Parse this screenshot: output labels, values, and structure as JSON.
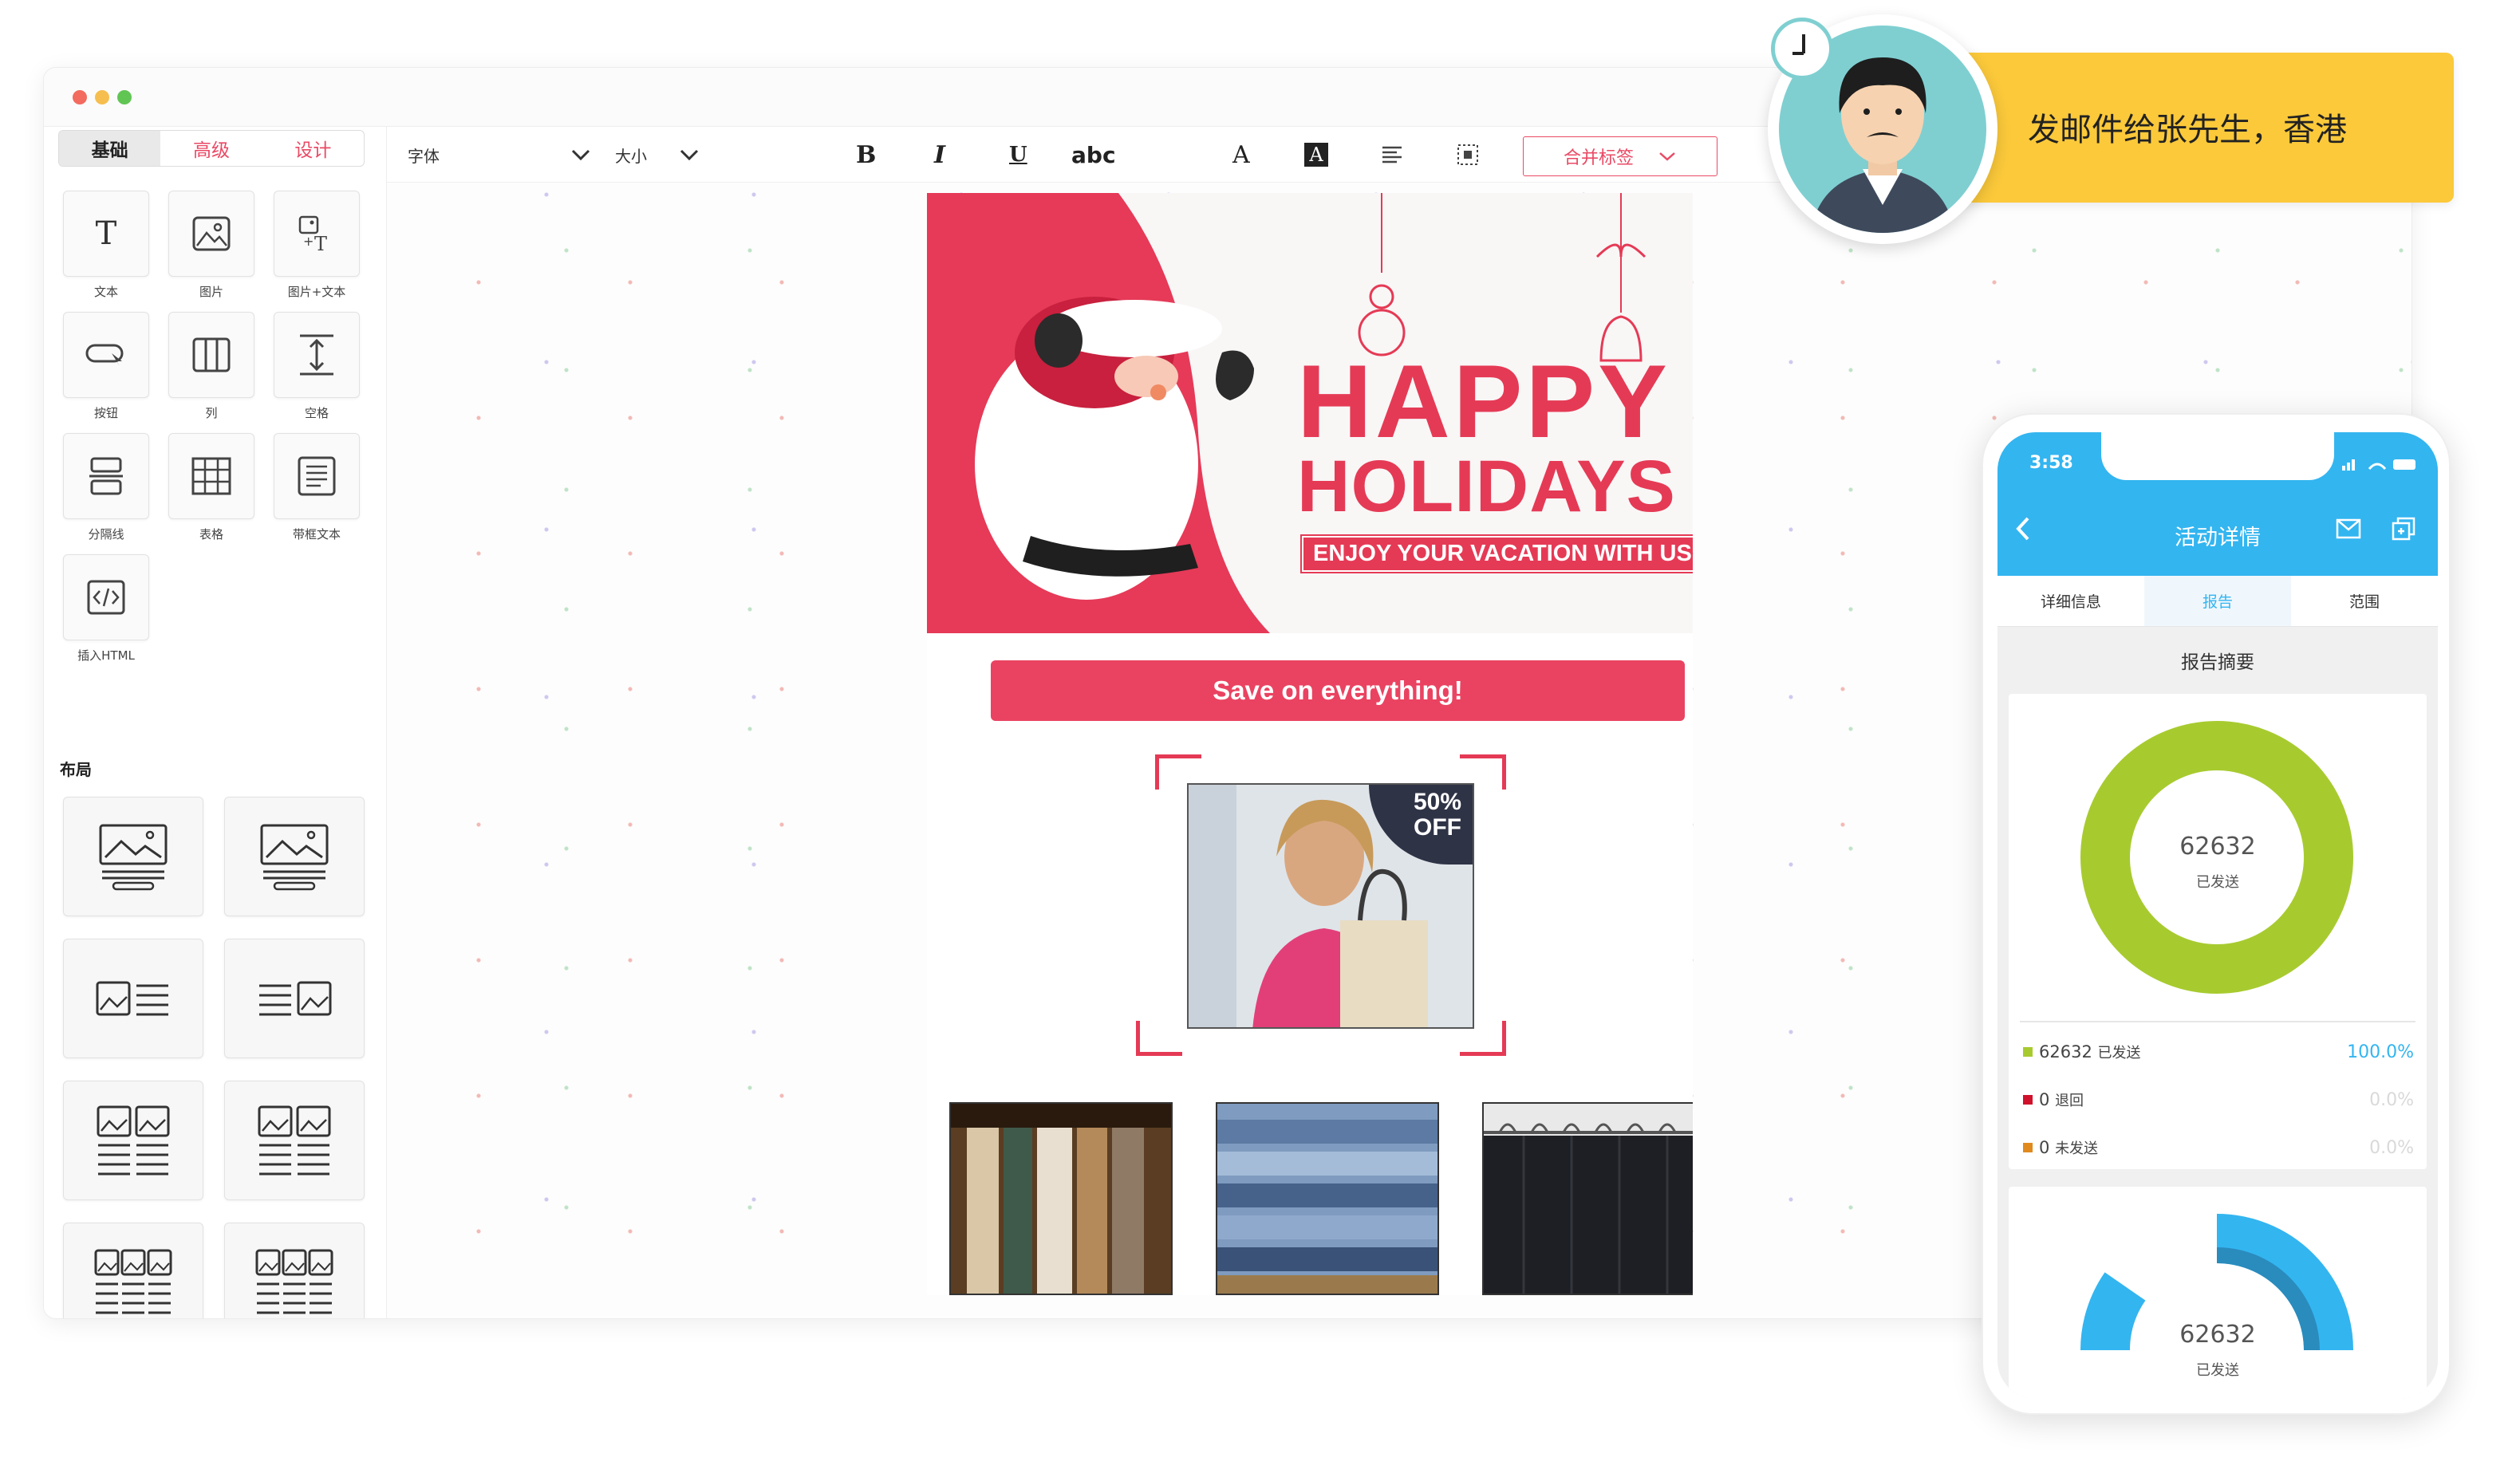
{
  "editor": {
    "tabs": [
      "基础",
      "高级",
      "设计"
    ],
    "tools": [
      {
        "icon": "text-icon",
        "label": "文本"
      },
      {
        "icon": "image-icon",
        "label": "图片"
      },
      {
        "icon": "image-text-icon",
        "label": "图片+文本"
      },
      {
        "icon": "button-icon",
        "label": "按钮"
      },
      {
        "icon": "columns-icon",
        "label": "列"
      },
      {
        "icon": "spacer-icon",
        "label": "空格"
      },
      {
        "icon": "divider-icon",
        "label": "分隔线"
      },
      {
        "icon": "table-icon",
        "label": "表格"
      },
      {
        "icon": "boxed-text-icon",
        "label": "带框文本"
      },
      {
        "icon": "html-icon",
        "label": "插入HTML"
      }
    ],
    "layout_title": "布局",
    "toolbar": {
      "font_label": "字体",
      "size_label": "大小",
      "bold": "B",
      "italic": "I",
      "underline": "U",
      "strike": "abc",
      "font_color": "A",
      "bg_color": "A",
      "merge_tags": "合并标签"
    },
    "accent_color": "#e94a65"
  },
  "email": {
    "headline_1": "HAPPY",
    "headline_2": "HOLIDAYS",
    "tagline": "ENJOY YOUR VACATION WITH US",
    "cta": "Save on everything!",
    "badge_1": "50%",
    "badge_2": "OFF"
  },
  "banner": {
    "text": "发邮件给张先生，香港",
    "color": "#fbc93a"
  },
  "phone": {
    "time": "3:58",
    "title": "活动详情",
    "tabs": [
      "详细信息",
      "报告",
      "范围"
    ],
    "section_title": "报告摘要",
    "donut_value": "62632",
    "donut_label": "已发送",
    "stats": [
      {
        "count": "62632",
        "label": "已发送",
        "percent": "100.0%",
        "color": "#a7cb2f"
      },
      {
        "count": "0",
        "label": "退回",
        "percent": "0.0%",
        "color": "#d0112b"
      },
      {
        "count": "0",
        "label": "未发送",
        "percent": "0.0%",
        "color": "#e08a1e"
      }
    ],
    "second_value": "62632",
    "second_label": "已发送",
    "accent_color": "#33b5f0"
  }
}
